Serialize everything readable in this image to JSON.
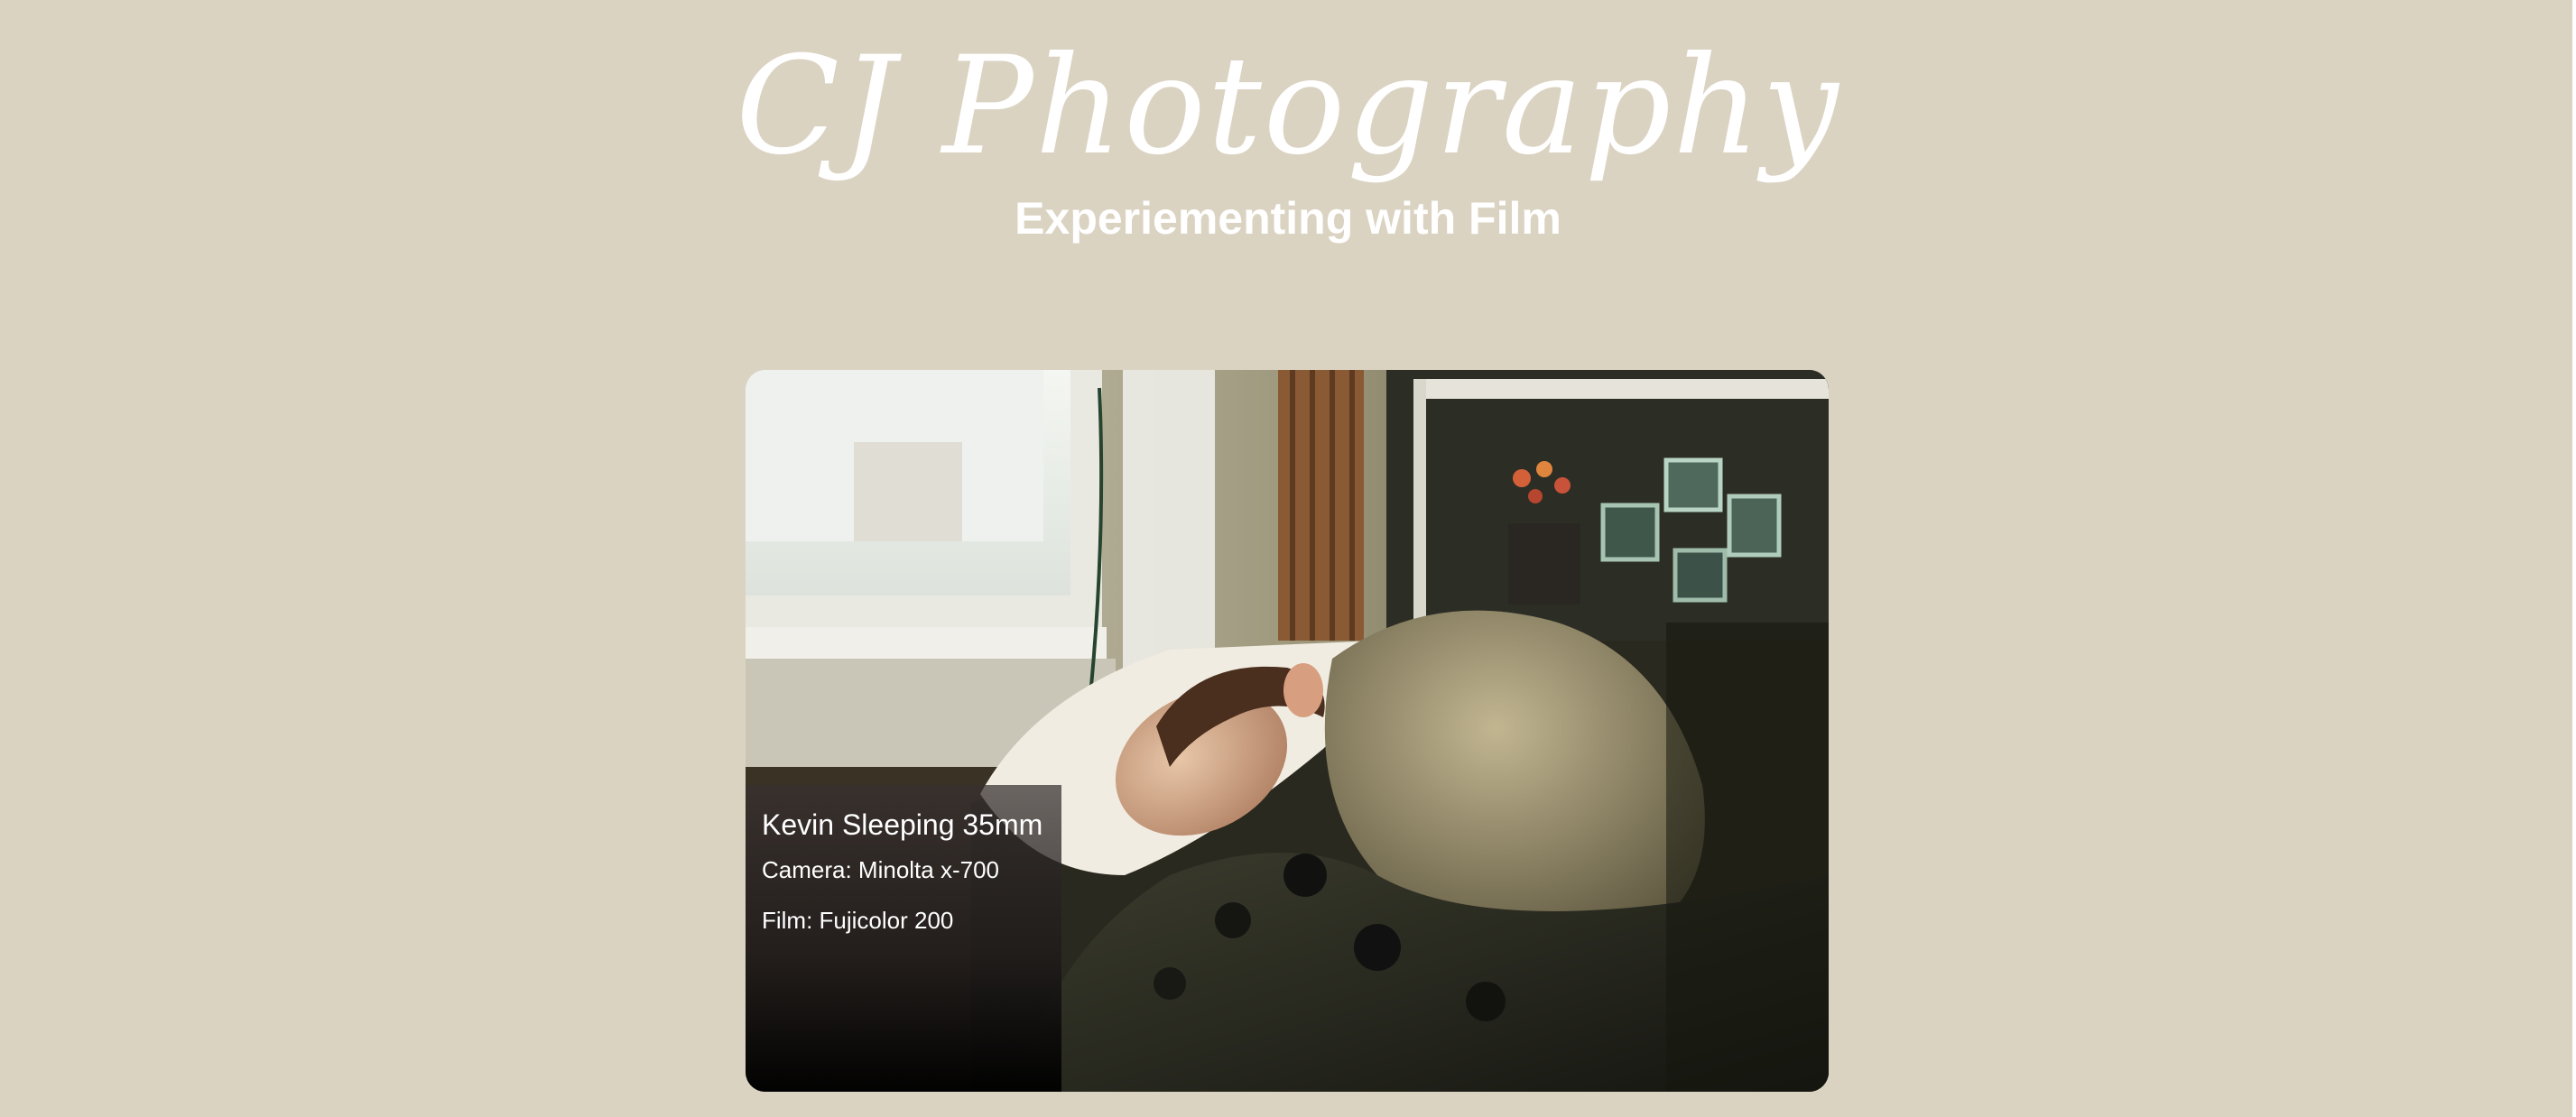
{
  "header": {
    "title": "CJ Photography",
    "subtitle": "Experiementing with Film"
  },
  "photo": {
    "title": "Kevin Sleeping 35mm",
    "camera": "Camera: Minolta x-700",
    "film": "Film: Fujicolor 200"
  },
  "colors": {
    "background": "#dbd3c2",
    "text": "#ffffff"
  }
}
